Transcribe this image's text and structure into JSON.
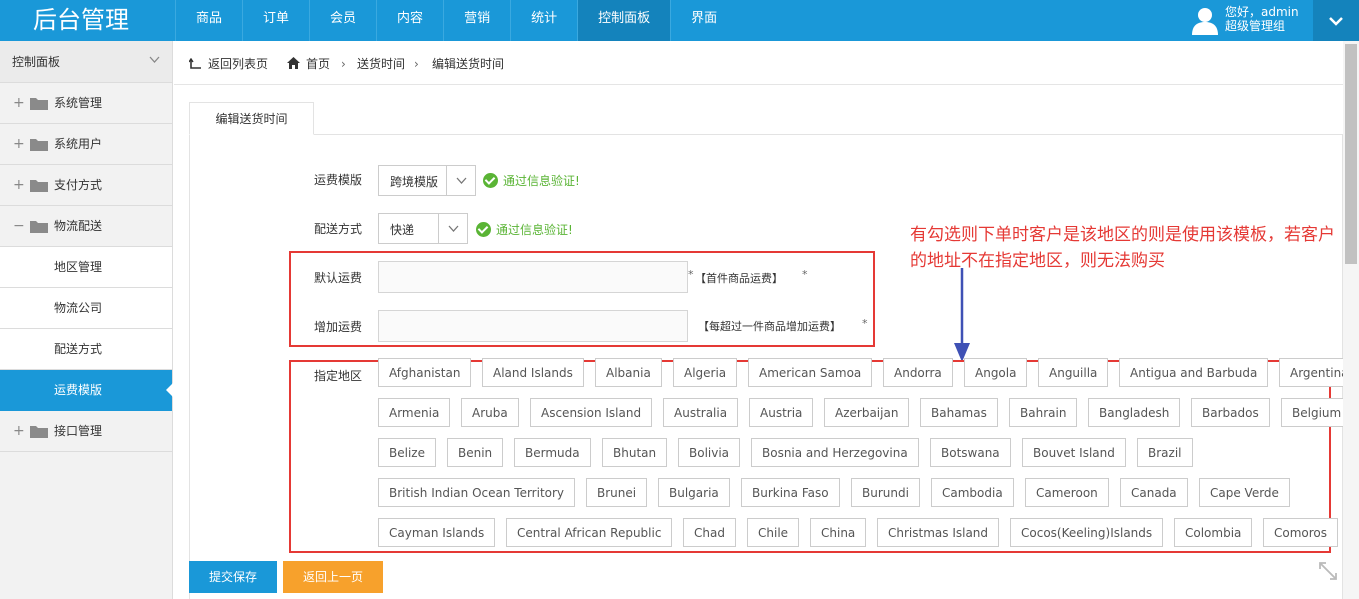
{
  "app": {
    "title": "后台管理"
  },
  "nav": {
    "items": [
      "商品",
      "订单",
      "会员",
      "内容",
      "营销",
      "统计",
      "控制面板",
      "界面"
    ],
    "active_index": 6
  },
  "user": {
    "greeting": "您好，admin",
    "role": "超级管理组"
  },
  "sidebar": {
    "header": "控制面板",
    "items": [
      {
        "label": "系统管理",
        "type": "group",
        "expanded": false
      },
      {
        "label": "系统用户",
        "type": "group",
        "expanded": false
      },
      {
        "label": "支付方式",
        "type": "group",
        "expanded": false
      },
      {
        "label": "物流配送",
        "type": "group",
        "expanded": true
      },
      {
        "label": "地区管理",
        "type": "sub"
      },
      {
        "label": "物流公司",
        "type": "sub"
      },
      {
        "label": "配送方式",
        "type": "sub"
      },
      {
        "label": "运费模版",
        "type": "sub",
        "active": true
      },
      {
        "label": "接口管理",
        "type": "group",
        "expanded": false
      }
    ]
  },
  "breadcrumb": {
    "back": "返回列表页",
    "home": "首页",
    "section": "送货时间",
    "current": "编辑送货时间"
  },
  "tab": {
    "label": "编辑送货时间"
  },
  "form": {
    "template": {
      "label": "运费模版",
      "value": "跨境模版",
      "valid": "通过信息验证!"
    },
    "shipping": {
      "label": "配送方式",
      "value": "快递",
      "valid": "通过信息验证!"
    },
    "default_fee": {
      "label": "默认运费",
      "value": "",
      "hint": "【首件商品运费】",
      "star_before": "*",
      "star_after": "*"
    },
    "extra_fee": {
      "label": "增加运费",
      "value": "",
      "hint": "【每超过一件商品增加运费】",
      "star_after": "*"
    },
    "regions_label": "指定地区"
  },
  "annotation": "有勾选则下单时客户是该地区的则是使用该模板，若客户的地址不在指定地区，则无法购买",
  "regions": [
    [
      "Afghanistan",
      "Aland Islands",
      "Albania",
      "Algeria",
      "American Samoa",
      "Andorra",
      "Angola",
      "Anguilla",
      "Antigua and Barbuda",
      "Argentina"
    ],
    [
      "Armenia",
      "Aruba",
      "Ascension Island",
      "Australia",
      "Austria",
      "Azerbaijan",
      "Bahamas",
      "Bahrain",
      "Bangladesh",
      "Barbados",
      "Belgium"
    ],
    [
      "Belize",
      "Benin",
      "Bermuda",
      "Bhutan",
      "Bolivia",
      "Bosnia and Herzegovina",
      "Botswana",
      "Bouvet Island",
      "Brazil"
    ],
    [
      "British Indian Ocean Territory",
      "Brunei",
      "Bulgaria",
      "Burkina Faso",
      "Burundi",
      "Cambodia",
      "Cameroon",
      "Canada",
      "Cape Verde"
    ],
    [
      "Cayman Islands",
      "Central African Republic",
      "Chad",
      "Chile",
      "China",
      "Christmas Island",
      "Cocos(Keeling)Islands",
      "Colombia",
      "Comoros"
    ]
  ],
  "buttons": {
    "submit": "提交保存",
    "back": "返回上一页"
  },
  "colors": {
    "primary": "#1a98d8",
    "active_nav": "#1483bc",
    "success": "#5ab435",
    "annotation": "#e53935",
    "back_button": "#f7a12c"
  }
}
